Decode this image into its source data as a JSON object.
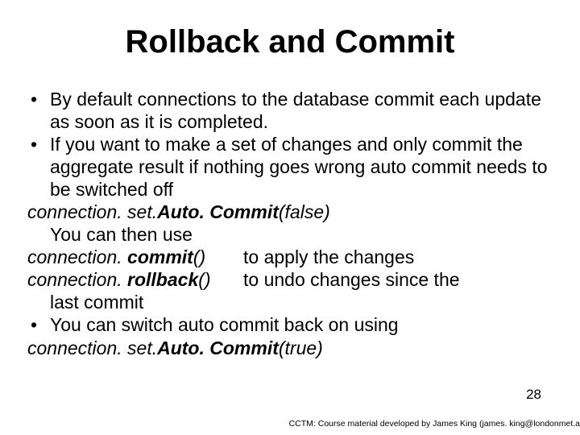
{
  "title": "Rollback and Commit",
  "bullets": {
    "b1": "By default connections to the database commit each update as soon as it is completed.",
    "b2": "If you want to make a set of changes and only commit the aggregate result if nothing goes wrong auto commit needs to be switched off",
    "b3": "You can switch auto commit back on using"
  },
  "lines": {
    "c1_pre": "connection. set.",
    "c1_bold": "Auto. Commit",
    "c1_post": "(false)",
    "useThen": "You can then use",
    "c2_pre": "connection. ",
    "c2_bold": "commit",
    "c2_post": "()",
    "c2_right": "to apply the changes",
    "c3_pre": "connection. ",
    "c3_bold": "rollback",
    "c3_post": "()",
    "c3_right": "to undo changes since the",
    "c3_cont": "last commit",
    "c4_pre": "connection. set.",
    "c4_bold": "Auto. Commit",
    "c4_post": "(true)"
  },
  "pageNumber": "28",
  "footer": "CCTM: Course material developed by James King (james. king@londonmet.a"
}
